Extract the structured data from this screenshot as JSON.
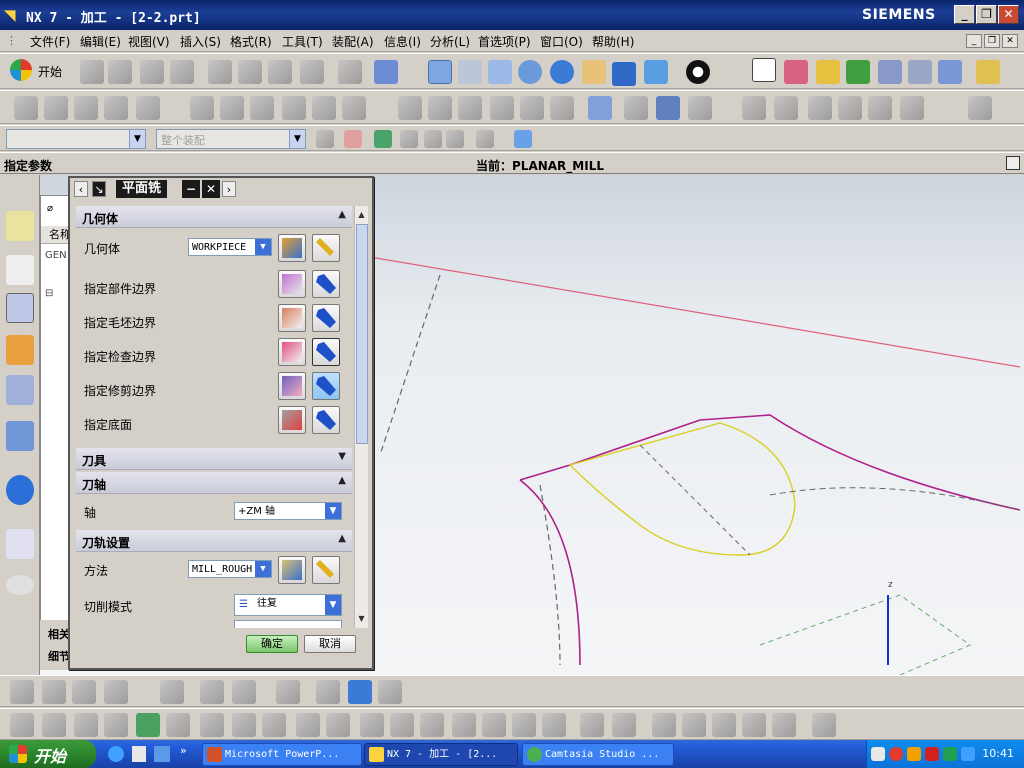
{
  "window": {
    "title": "NX 7 - 加工 - [2-2.prt]",
    "brand": "SIEMENS",
    "controls": [
      "_",
      "❐",
      "✕"
    ]
  },
  "menu": {
    "items": [
      "文件(F)",
      "编辑(E)",
      "视图(V)",
      "插入(S)",
      "格式(R)",
      "工具(T)",
      "装配(A)",
      "信息(I)",
      "分析(L)",
      "首选项(P)",
      "窗口(O)",
      "帮助(H)"
    ],
    "mdi_controls": [
      "_",
      "❐",
      "✕"
    ]
  },
  "toolbar": {
    "start_label": "开始",
    "assembly_combo": "整个装配",
    "selection_combo": ""
  },
  "status": {
    "prompt": "指定参数",
    "current": "当前：PLANAR_MILL"
  },
  "nav": {
    "column_header": "名称",
    "row_1": "GEN",
    "extra_1": "相关",
    "extra_2": "细节"
  },
  "dialog": {
    "title": "平面铣",
    "sections": {
      "geometry": "几何体",
      "tool": "刀具",
      "axis": "刀轴",
      "path_settings": "刀轨设置"
    },
    "geometry_label": "几何体",
    "geometry_value": "WORKPIECE",
    "rows": [
      "指定部件边界",
      "指定毛坯边界",
      "指定检查边界",
      "指定修剪边界",
      "指定底面"
    ],
    "axis_label": "轴",
    "axis_value": "+ZM 轴",
    "method_label": "方法",
    "method_value": "MILL_ROUGH",
    "cut_mode_label": "切削模式",
    "cut_mode_value": "往复",
    "ok": "确定",
    "cancel": "取消"
  },
  "taskbar": {
    "start": "开始",
    "tasks": [
      "Microsoft PowerP...",
      "NX 7 - 加工 - [2...",
      "Camtasia Studio ..."
    ],
    "clock": "10:41"
  },
  "colors": {
    "title_bg": "#0a246a",
    "curve_magenta": "#b0208c",
    "curve_yellow": "#d8d020",
    "curve_red": "#e0607a",
    "ok_green": "#4caf50"
  }
}
